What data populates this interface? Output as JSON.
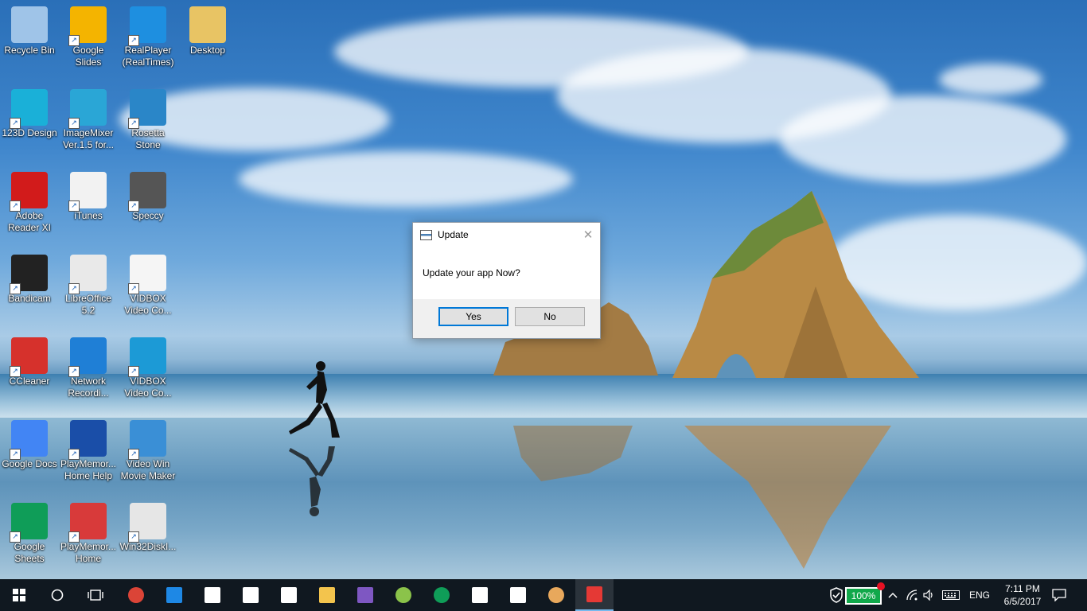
{
  "desktop": {
    "icons": [
      {
        "label": "Recycle Bin",
        "icon": "recycle-bin-icon",
        "color": "#9fc4e8",
        "shortcut": false
      },
      {
        "label": "Google Slides",
        "icon": "google-slides-icon",
        "color": "#f4b400",
        "shortcut": true
      },
      {
        "label": "RealPlayer (RealTimes)",
        "icon": "realplayer-icon",
        "color": "#1e8fe0",
        "shortcut": true
      },
      {
        "label": "Desktop",
        "icon": "chrome-folder-icon",
        "color": "#e8c464",
        "shortcut": false
      },
      {
        "label": "123D Design",
        "icon": "123d-design-icon",
        "color": "#1ab0d8",
        "shortcut": true
      },
      {
        "label": "ImageMixer Ver.1.5 for...",
        "icon": "imagemixer-icon",
        "color": "#2aa6d6",
        "shortcut": true
      },
      {
        "label": "Rosetta Stone",
        "icon": "rosetta-stone-icon",
        "color": "#2a86c8",
        "shortcut": true
      },
      {
        "label": "Adobe Reader XI",
        "icon": "adobe-reader-icon",
        "color": "#d21b1b",
        "shortcut": true
      },
      {
        "label": "iTunes",
        "icon": "itunes-icon",
        "color": "#f2f2f2",
        "shortcut": true
      },
      {
        "label": "Speccy",
        "icon": "speccy-icon",
        "color": "#555555",
        "shortcut": true
      },
      {
        "label": "Bandicam",
        "icon": "bandicam-icon",
        "color": "#222222",
        "shortcut": true
      },
      {
        "label": "LibreOffice 5.2",
        "icon": "libreoffice-icon",
        "color": "#e9e9e9",
        "shortcut": true
      },
      {
        "label": "VIDBOX Video Co...",
        "icon": "pdf-icon",
        "color": "#f5f5f5",
        "shortcut": true
      },
      {
        "label": "CCleaner",
        "icon": "ccleaner-icon",
        "color": "#d6312c",
        "shortcut": true
      },
      {
        "label": "Network Recordi...",
        "icon": "network-recording-icon",
        "color": "#1f7fd6",
        "shortcut": true
      },
      {
        "label": "VIDBOX Video Co...",
        "icon": "vidbox-icon",
        "color": "#1c9ad6",
        "shortcut": true
      },
      {
        "label": "Google Docs",
        "icon": "google-docs-icon",
        "color": "#4285f4",
        "shortcut": true
      },
      {
        "label": "PlayMemor... Home Help",
        "icon": "help-icon",
        "color": "#1a4ea8",
        "shortcut": true
      },
      {
        "label": "Video Win Movie Maker",
        "icon": "movie-maker-icon",
        "color": "#3a8fd6",
        "shortcut": true
      },
      {
        "label": "Google Sheets",
        "icon": "google-sheets-icon",
        "color": "#0f9d58",
        "shortcut": true
      },
      {
        "label": "PlayMemor... Home",
        "icon": "playmemories-icon",
        "color": "#d83a3a",
        "shortcut": true
      },
      {
        "label": "Win32DiskI...",
        "icon": "win32diskimager-icon",
        "color": "#e6e6e6",
        "shortcut": true
      }
    ]
  },
  "dialog": {
    "title": "Update",
    "message": "Update your app Now?",
    "yes_label": "Yes",
    "no_label": "No",
    "close_glyph": "✕"
  },
  "taskbar": {
    "start_icon": "windows-start-icon",
    "search_glyph": "○",
    "apps": [
      {
        "name": "chrome-icon"
      },
      {
        "name": "edge-icon"
      },
      {
        "name": "vectr-icon"
      },
      {
        "name": "mail-icon"
      },
      {
        "name": "calendar-icon"
      },
      {
        "name": "file-explorer-icon"
      },
      {
        "name": "visual-studio-icon"
      },
      {
        "name": "android-studio-icon"
      },
      {
        "name": "hangouts-icon"
      },
      {
        "name": "calculator-icon"
      },
      {
        "name": "news-icon"
      },
      {
        "name": "lock-app-icon"
      },
      {
        "name": "active-app-icon"
      }
    ],
    "battery": "100%",
    "language": "ENG",
    "time": "7:11 PM",
    "date": "6/5/2017",
    "chevron": "^"
  }
}
